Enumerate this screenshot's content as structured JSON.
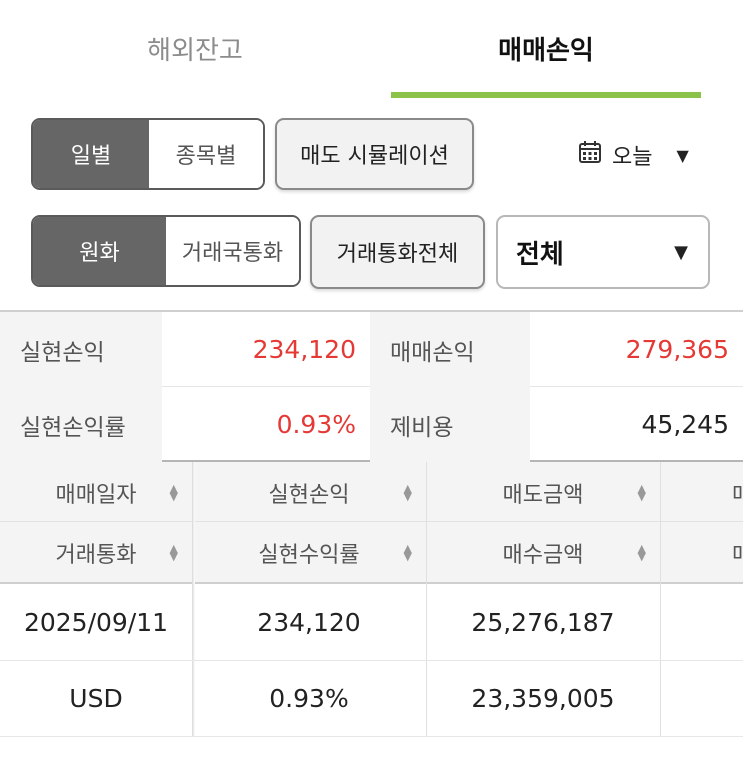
{
  "tabs": [
    {
      "label": "해외잔고",
      "active": false
    },
    {
      "label": "매매손익",
      "active": true
    }
  ],
  "accent_color": "#8bc34a",
  "period_toggle": {
    "options": [
      "일별",
      "종목별"
    ],
    "selected": "일별"
  },
  "simulation_button": "매도 시뮬레이션",
  "date_filter": {
    "label": "오늘",
    "icon": "calendar-icon"
  },
  "currency_toggle": {
    "options": [
      "원화",
      "거래국통화"
    ],
    "selected": "원화"
  },
  "currency_all_button": "거래통화전체",
  "market_select": {
    "value": "전체"
  },
  "summary": {
    "realized_pl_label": "실현손익",
    "realized_pl_value": "234,120",
    "trade_pl_label": "매매손익",
    "trade_pl_value": "279,365",
    "realized_rate_label": "실현손익률",
    "realized_rate_value": "0.93%",
    "fees_label": "제비용",
    "fees_value": "45,245"
  },
  "table": {
    "headers_row1": [
      "매매일자",
      "실현손익",
      "매도금액",
      "매"
    ],
    "headers_row2": [
      "거래통화",
      "실현수익률",
      "매수금액",
      "매"
    ],
    "rows": [
      {
        "c0": "2025/09/11",
        "c1": "234,120",
        "c2": "25,276,187"
      },
      {
        "c0": "USD",
        "c1": "0.93%",
        "c2": "23,359,005"
      }
    ]
  },
  "colors": {
    "positive": "#e53935",
    "selected_segment": "#666666"
  }
}
